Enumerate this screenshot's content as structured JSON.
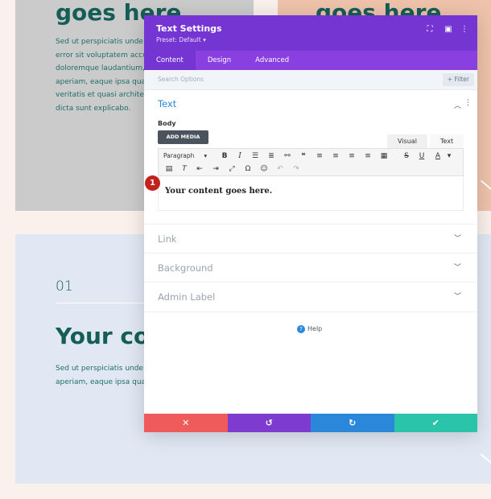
{
  "background": {
    "top_left_heading": "goes here.",
    "top_right_heading": "goes here.",
    "top_left_paragraph": [
      "Sed ut perspiciatis unde o",
      "error sit voluptatem accu",
      "doloremque laudantium,",
      "aperiam, eaque ipsa quae",
      "veritatis et quasi architec",
      "dicta sunt explicabo."
    ],
    "card_number": "01",
    "card_heading": "Your con",
    "card_paragraph": [
      "Sed ut perspiciatis unde o",
      "aperiam, eaque ipsa quae"
    ]
  },
  "modal": {
    "title": "Text Settings",
    "preset": "Preset: Default ▾",
    "tabs": [
      {
        "label": "Content",
        "active": true
      },
      {
        "label": "Design",
        "active": false
      },
      {
        "label": "Advanced",
        "active": false
      }
    ],
    "search_placeholder": "Search Options",
    "filter_label": "+ Filter",
    "text_section": {
      "title": "Text",
      "body_label": "Body",
      "add_media": "ADD MEDIA",
      "editor_tabs": [
        "Visual",
        "Text"
      ],
      "paragraph_select": "Paragraph",
      "content": "Your content goes here.",
      "step_badge": "1"
    },
    "sections": [
      "Link",
      "Background",
      "Admin Label"
    ],
    "help": "Help",
    "footer_colors": {
      "cancel": "#ef5b5b",
      "undo": "#7d3bd0",
      "redo": "#2b87da",
      "save": "#29c4a9"
    }
  },
  "colors": {
    "header_purple": "#7535d2",
    "tab_purple": "#8a3fe0",
    "accent_blue": "#2b87da",
    "teal_heading": "#155e57"
  }
}
